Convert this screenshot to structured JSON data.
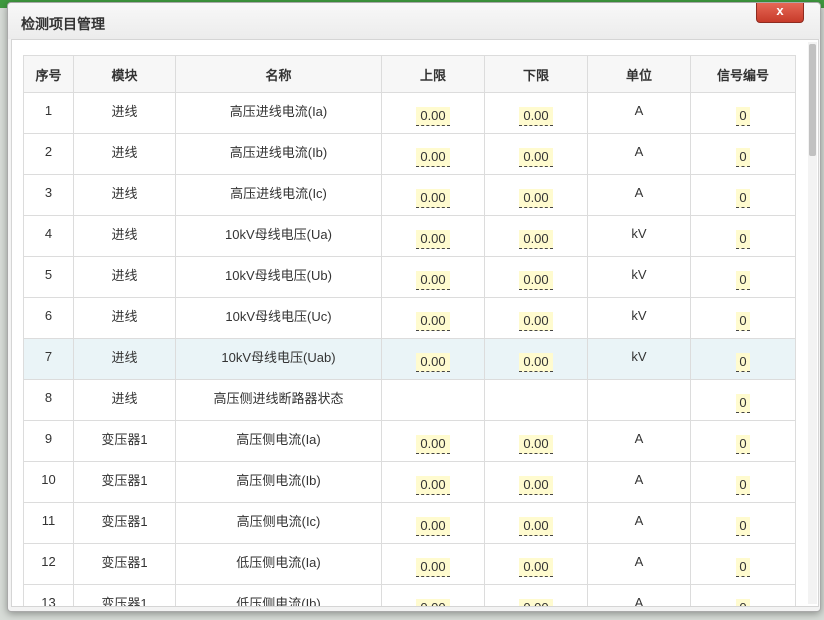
{
  "dialog": {
    "title": "检测项目管理",
    "close_label": "x"
  },
  "table": {
    "headers": [
      "序号",
      "模块",
      "名称",
      "上限",
      "下限",
      "单位",
      "信号编号"
    ],
    "rows": [
      {
        "no": "1",
        "module": "进线",
        "name": "高压进线电流(Ia)",
        "upper": "0.00",
        "lower": "0.00",
        "unit": "A",
        "signal": "0"
      },
      {
        "no": "2",
        "module": "进线",
        "name": "高压进线电流(Ib)",
        "upper": "0.00",
        "lower": "0.00",
        "unit": "A",
        "signal": "0"
      },
      {
        "no": "3",
        "module": "进线",
        "name": "高压进线电流(Ic)",
        "upper": "0.00",
        "lower": "0.00",
        "unit": "A",
        "signal": "0"
      },
      {
        "no": "4",
        "module": "进线",
        "name": "10kV母线电压(Ua)",
        "upper": "0.00",
        "lower": "0.00",
        "unit": "kV",
        "signal": "0"
      },
      {
        "no": "5",
        "module": "进线",
        "name": "10kV母线电压(Ub)",
        "upper": "0.00",
        "lower": "0.00",
        "unit": "kV",
        "signal": "0"
      },
      {
        "no": "6",
        "module": "进线",
        "name": "10kV母线电压(Uc)",
        "upper": "0.00",
        "lower": "0.00",
        "unit": "kV",
        "signal": "0"
      },
      {
        "no": "7",
        "module": "进线",
        "name": "10kV母线电压(Uab)",
        "upper": "0.00",
        "lower": "0.00",
        "unit": "kV",
        "signal": "0"
      },
      {
        "no": "8",
        "module": "进线",
        "name": "高压侧进线断路器状态",
        "upper": "",
        "lower": "",
        "unit": "",
        "signal": "0"
      },
      {
        "no": "9",
        "module": "变压器1",
        "name": "高压侧电流(Ia)",
        "upper": "0.00",
        "lower": "0.00",
        "unit": "A",
        "signal": "0"
      },
      {
        "no": "10",
        "module": "变压器1",
        "name": "高压侧电流(Ib)",
        "upper": "0.00",
        "lower": "0.00",
        "unit": "A",
        "signal": "0"
      },
      {
        "no": "11",
        "module": "变压器1",
        "name": "高压侧电流(Ic)",
        "upper": "0.00",
        "lower": "0.00",
        "unit": "A",
        "signal": "0"
      },
      {
        "no": "12",
        "module": "变压器1",
        "name": "低压侧电流(Ia)",
        "upper": "0.00",
        "lower": "0.00",
        "unit": "A",
        "signal": "0"
      },
      {
        "no": "13",
        "module": "变压器1",
        "name": "低压侧电流(Ib)",
        "upper": "0.00",
        "lower": "0.00",
        "unit": "A",
        "signal": "0"
      }
    ]
  },
  "colors": {
    "field_bg": "#fffbcf",
    "highlight_row": "#eaf4f7",
    "close_button": "#d9503f"
  }
}
